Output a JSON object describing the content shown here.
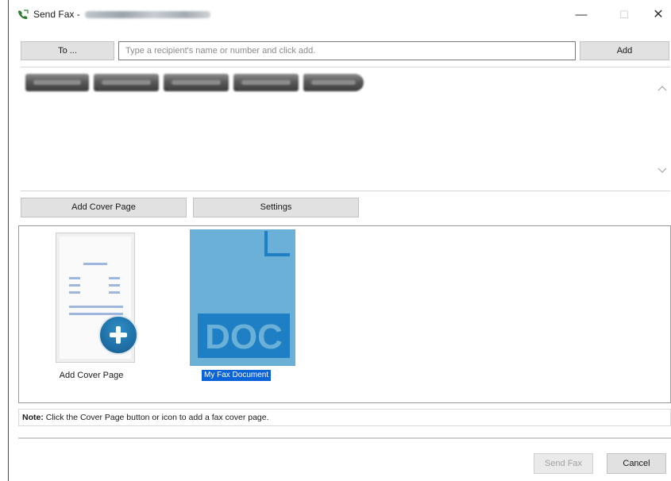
{
  "window": {
    "title": "Send Fax - ",
    "min_glyph": "—",
    "max_glyph": "☐",
    "close_glyph": "✕"
  },
  "recipients": {
    "to_button_label": "To ...",
    "input_placeholder": "Type a recipient's name or number and click add.",
    "input_value": "",
    "add_button_label": "Add",
    "scroll_up_glyph": "^",
    "scroll_down_glyph": "v"
  },
  "actions": {
    "add_cover_page_label": "Add Cover Page",
    "settings_label": "Settings"
  },
  "documents": {
    "cover_page_label": "Add Cover Page",
    "fax_document_label": "My Fax Document",
    "fax_document_badge": "DOC",
    "icons": [
      "cover-page-icon",
      "plus-icon",
      "doc-file-icon"
    ]
  },
  "note": {
    "bold": "Note:",
    "text": " Click the Cover Page button or icon to add a fax cover page."
  },
  "footer": {
    "send_label": "Send Fax",
    "cancel_label": "Cancel"
  },
  "colors": {
    "selection": "#0a64d8",
    "doc_tile_bg": "#6ab0d7",
    "doc_icon": "#1e7fc4",
    "plus_badge": "#1c6aa0"
  }
}
